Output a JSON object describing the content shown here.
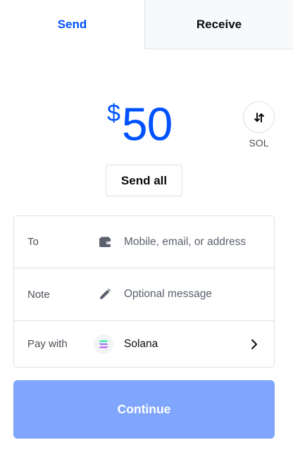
{
  "tabs": {
    "send_label": "Send",
    "receive_label": "Receive",
    "active": "send"
  },
  "amount": {
    "currency_symbol": "$",
    "value": "50"
  },
  "asset": {
    "label": "SOL",
    "icon": "swap-arrows-icon"
  },
  "send_all_label": "Send all",
  "form": {
    "to": {
      "label": "To",
      "icon": "wallet-icon",
      "placeholder": "Mobile, email, or address"
    },
    "note": {
      "label": "Note",
      "icon": "pencil-icon",
      "placeholder": "Optional message"
    },
    "pay_with": {
      "label": "Pay with",
      "icon": "solana-logo-icon",
      "value": "Solana",
      "trailing_icon": "chevron-right-icon"
    }
  },
  "continue_label": "Continue",
  "colors": {
    "accent": "#0052ff",
    "continue_disabled": "#7fa6fc",
    "border": "#dee1e6"
  }
}
